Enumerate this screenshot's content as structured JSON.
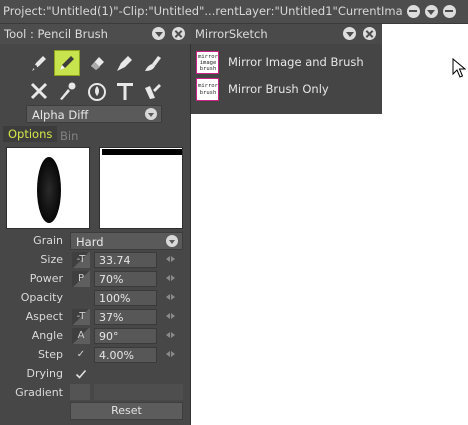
{
  "titlebar": {
    "title": "Project:\"Untitled(1)\"-Clip:\"Untitled\"...rentLayer:\"Untitled1\"CurrentImage:0"
  },
  "tool_panel": {
    "title": "Tool : Pencil Brush",
    "tools": [
      {
        "name": "pen-tool-icon",
        "active": false
      },
      {
        "name": "pencil-brush-icon",
        "active": true
      },
      {
        "name": "eraser-icon",
        "active": false
      },
      {
        "name": "marker-icon",
        "active": false
      },
      {
        "name": "airbrush-icon",
        "active": false
      },
      {
        "name": "crossed-brushes-icon",
        "active": false
      },
      {
        "name": "dropper-icon",
        "active": false
      },
      {
        "name": "fill-drop-icon",
        "active": false
      },
      {
        "name": "text-tool-icon",
        "active": false
      },
      {
        "name": "selection-brush-icon",
        "active": false
      }
    ],
    "blend_mode": "Alpha Diff",
    "tabs": [
      "Options",
      "Bin"
    ],
    "grain": {
      "label": "Grain",
      "value": "Hard"
    },
    "params": [
      {
        "label": "Size",
        "modifier": "-T",
        "value": "33.74"
      },
      {
        "label": "Power",
        "modifier": "P",
        "value": "70%"
      },
      {
        "label": "Opacity",
        "modifier": "",
        "value": "100%"
      },
      {
        "label": "Aspect",
        "modifier": "-T",
        "value": "37%"
      },
      {
        "label": "Angle",
        "modifier": "A",
        "value": "90°"
      },
      {
        "label": "Step",
        "modifier": "✓",
        "value": "4.00%"
      }
    ],
    "drying": {
      "label": "Drying",
      "checked": true
    },
    "gradient": {
      "label": "Gradient"
    },
    "reset_label": "Reset"
  },
  "mirror_panel": {
    "title": "MirrorSketch",
    "items": [
      {
        "label": "Mirror Image and Brush",
        "thumb": [
          "mirror",
          "image",
          "brush"
        ]
      },
      {
        "label": "Mirror Brush Only",
        "thumb": [
          "mirror",
          "brush"
        ]
      }
    ]
  },
  "colors": {
    "accent": "#c7e34d",
    "options_tab": "#d6e84a",
    "thumb_border": "#cc2288"
  }
}
